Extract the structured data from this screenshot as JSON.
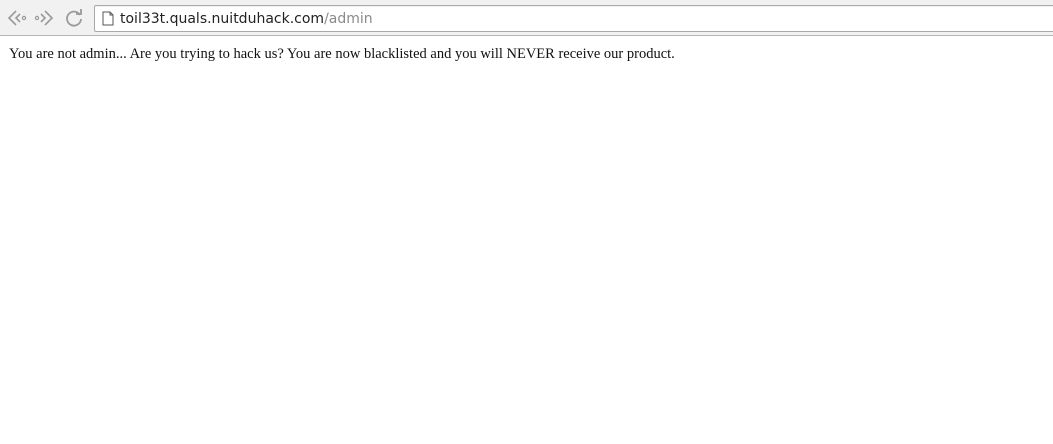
{
  "browser": {
    "url": {
      "host": "toil33t.quals.nuitduhack.com",
      "path": "/admin"
    },
    "buttons": {
      "back_icon": "back-arrow-icon",
      "forward_icon": "forward-arrow-icon",
      "reload_icon": "reload-icon"
    },
    "page_icon": "document-icon"
  },
  "page": {
    "message": "You are not admin... Are you trying to hack us? You are now blacklisted and you will NEVER receive our product."
  }
}
